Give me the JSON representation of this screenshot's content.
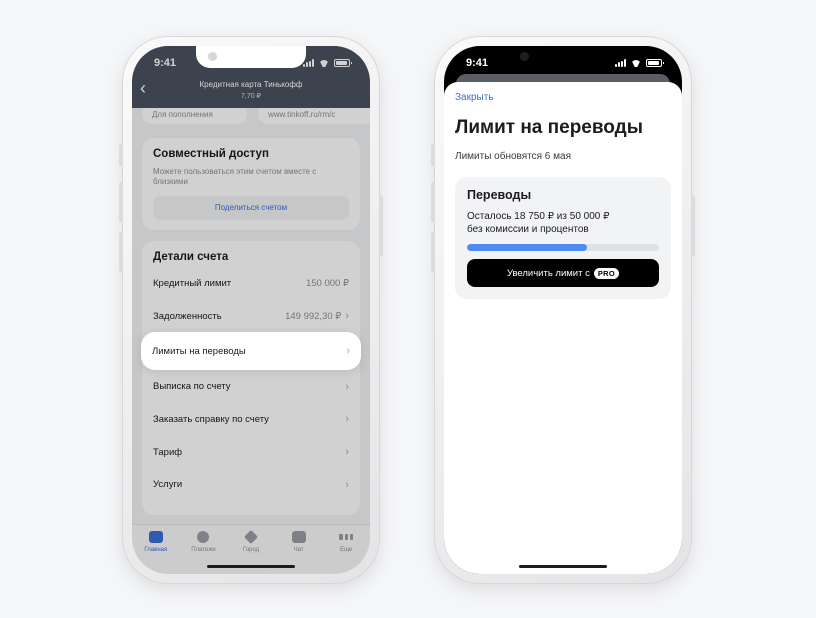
{
  "colors": {
    "accent": "#3b6fd8",
    "progress_fill": "#4f8bf0",
    "nav_dark": "#4a5260"
  },
  "left_phone": {
    "status": {
      "time": "9:41"
    },
    "nav": {
      "back_icon": "chevron-left-icon",
      "title": "Кредитная карта Тинькофф",
      "subtitle": "7,70 ₽"
    },
    "top_pills": [
      {
        "label": "Для пополнения"
      },
      {
        "label": "www.tinkoff.ru/rm/c"
      }
    ],
    "shared_access": {
      "title": "Совместный доступ",
      "description": "Можете пользоваться этим счетом вместе с близкими",
      "button": "Поделиться счетом"
    },
    "account_details": {
      "title": "Детали счета",
      "rows": [
        {
          "label": "Кредитный лимит",
          "value": "150 000 ₽"
        },
        {
          "label": "Задолженность",
          "value": "149 992,30 ₽"
        },
        {
          "label": "Лимиты на переводы",
          "value": ""
        },
        {
          "label": "Выписка по счету",
          "value": ""
        },
        {
          "label": "Заказать справку по счету",
          "value": ""
        },
        {
          "label": "Тариф",
          "value": ""
        },
        {
          "label": "Услуги",
          "value": ""
        }
      ]
    },
    "tabbar": [
      {
        "label": "Главная",
        "icon": "card-icon",
        "active": true
      },
      {
        "label": "Платежи",
        "icon": "payments-icon",
        "active": false
      },
      {
        "label": "Город",
        "icon": "city-icon",
        "active": false
      },
      {
        "label": "Чат",
        "icon": "chat-icon",
        "active": false
      },
      {
        "label": "Еще",
        "icon": "more-icon",
        "active": false
      }
    ]
  },
  "right_phone": {
    "status": {
      "time": "9:41"
    },
    "close_label": "Закрыть",
    "title": "Лимит на переводы",
    "subtitle": "Лимиты обновятся 6 мая",
    "card": {
      "title": "Переводы",
      "line1": "Осталось 18 750 ₽ из 50 000 ₽",
      "line2": "без комиссии и процентов",
      "progress_fraction": 0.625,
      "button_label": "Увеличить лимит с",
      "badge": "PRO"
    }
  }
}
